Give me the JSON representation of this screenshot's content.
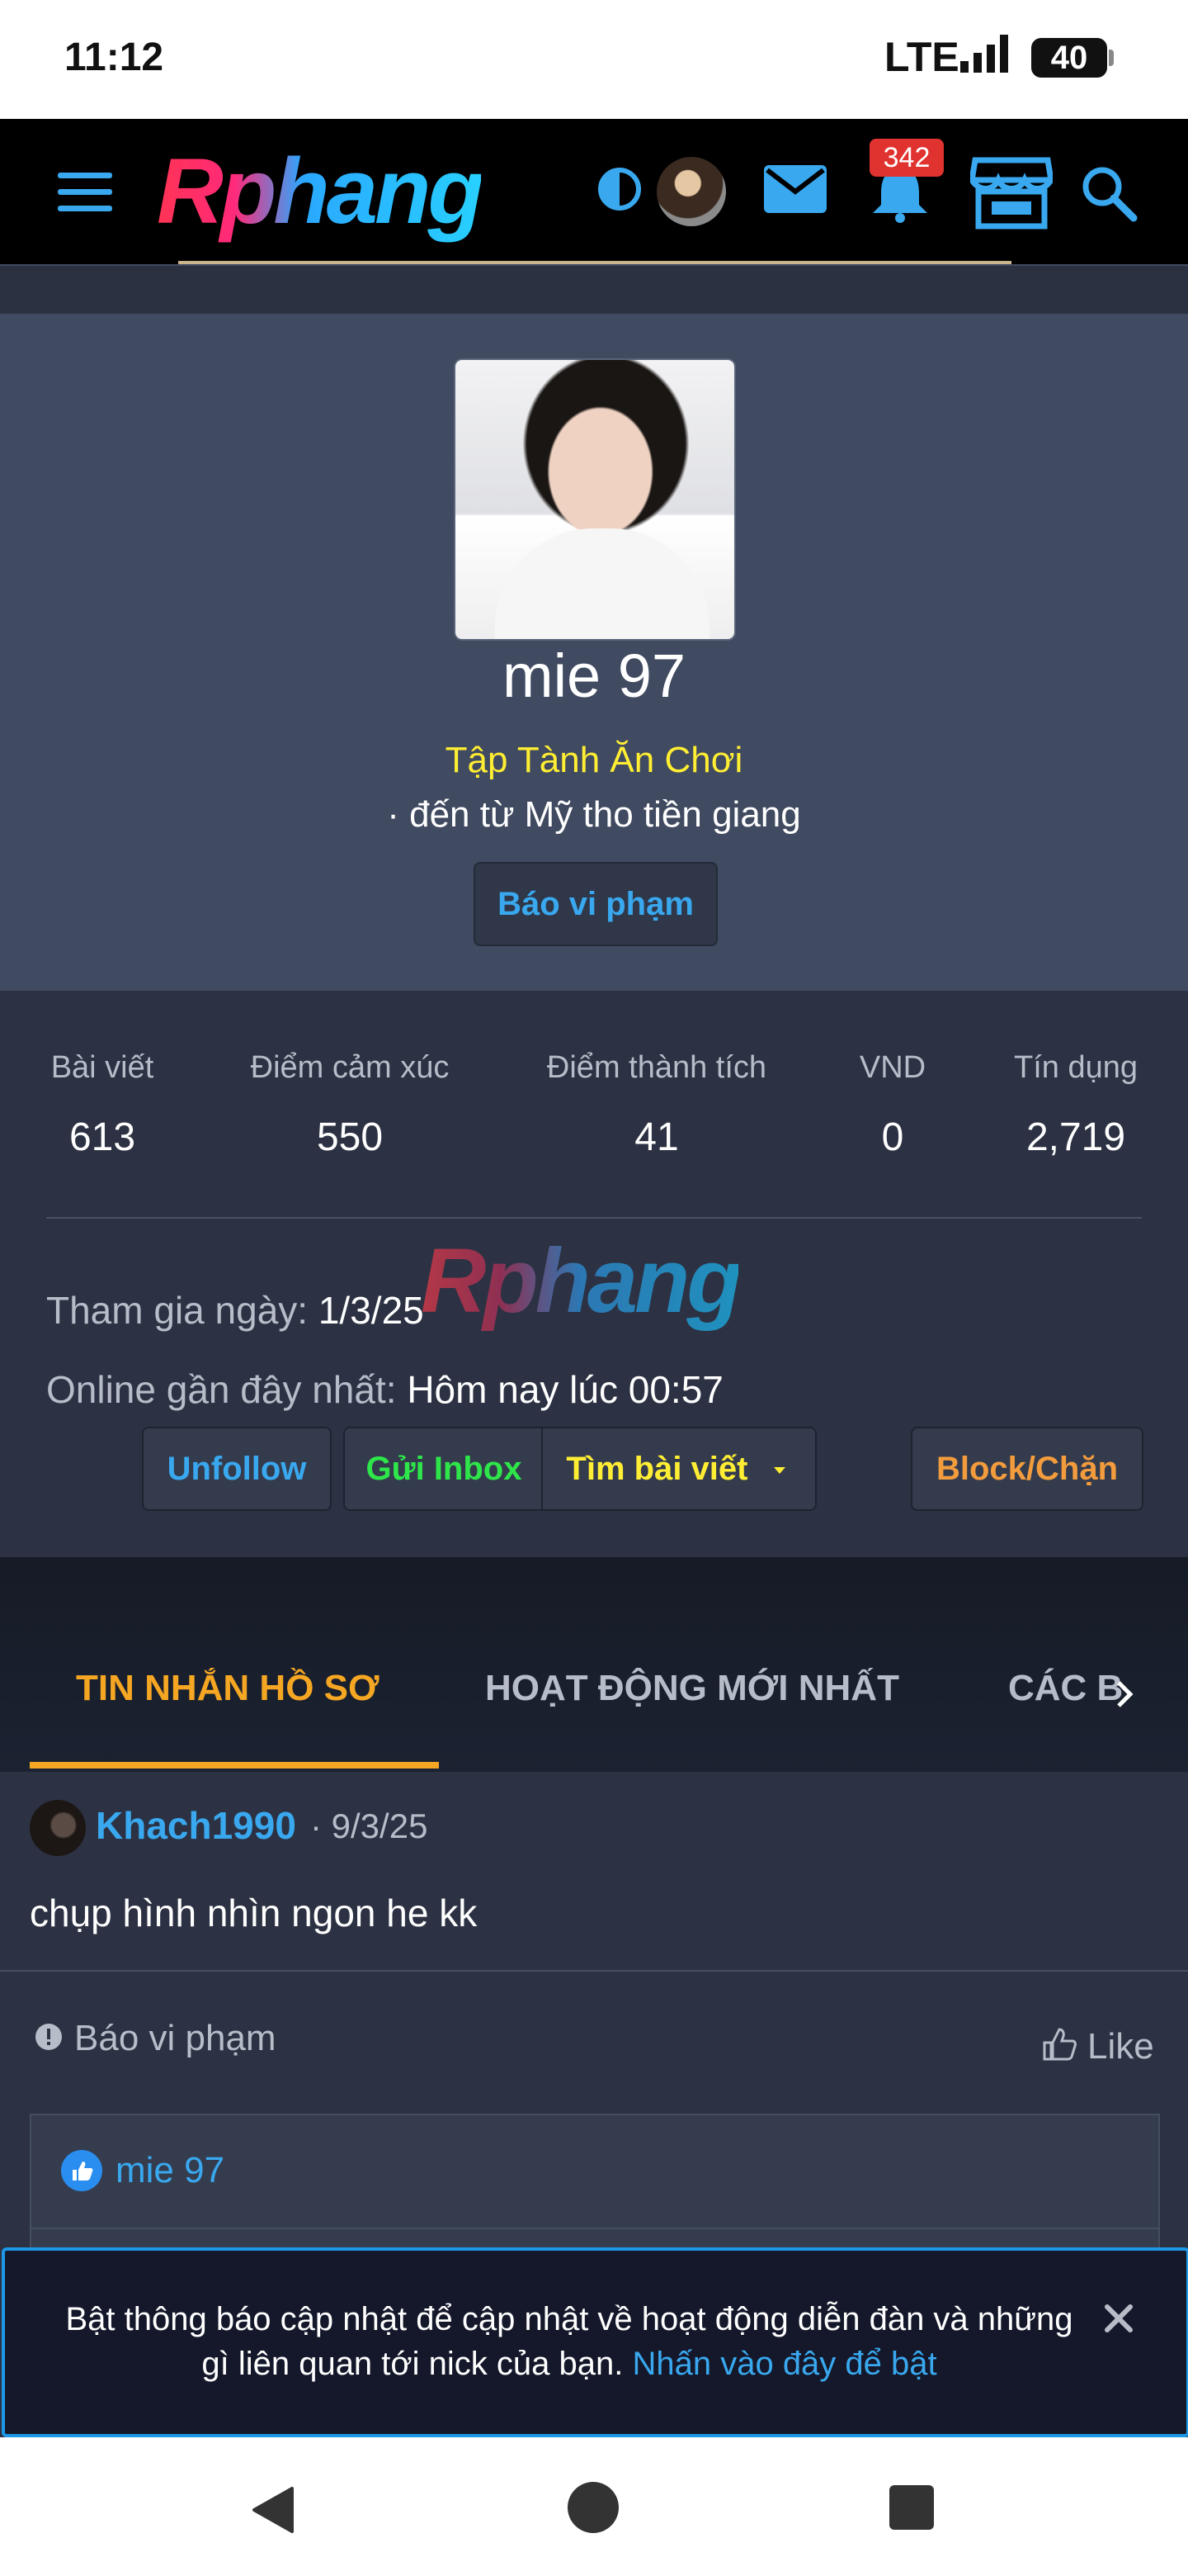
{
  "status_bar": {
    "time": "11:12",
    "network": "LTE",
    "battery": "40"
  },
  "header": {
    "logo_text": "Rphang",
    "notification_count": "342",
    "icons": [
      "menu-icon",
      "theme-toggle-icon",
      "avatar",
      "mail-icon",
      "bell-icon",
      "store-icon",
      "search-icon"
    ]
  },
  "profile": {
    "name": "mie 97",
    "title": "Tập Tành Ăn Chơi",
    "location": "· đến từ Mỹ tho tiền giang",
    "report_button": "Báo vi phạm"
  },
  "stats": [
    {
      "label": "Bài viết",
      "value": "613"
    },
    {
      "label": "Điểm cảm xúc",
      "value": "550"
    },
    {
      "label": "Điểm thành tích",
      "value": "41"
    },
    {
      "label": "VND",
      "value": "0"
    },
    {
      "label": "Tín dụng",
      "value": "2,719"
    }
  ],
  "watermark": "Rphang",
  "info": {
    "joined_label": "Tham gia ngày:",
    "joined_value": "1/3/25",
    "online_label": "Online gần đây nhất:",
    "online_value": "Hôm nay lúc 00:57"
  },
  "actions": {
    "unfollow": "Unfollow",
    "inbox": "Gửi Inbox",
    "find_posts": "Tìm bài viết",
    "block": "Block/Chặn"
  },
  "tabs": [
    {
      "label": "TIN NHẮN HỒ SƠ",
      "active": true
    },
    {
      "label": "HOẠT ĐỘNG MỚI NHẤT",
      "active": false
    },
    {
      "label": "CÁC B",
      "active": false
    }
  ],
  "post": {
    "author": "Khach1990",
    "date": "· 9/3/25",
    "body": "chụp hình nhìn ngon he kk",
    "report": "Báo vi phạm",
    "like": "Like",
    "liked_by": "mie 97"
  },
  "notice": {
    "text": "Bật thông báo cập nhật để cập nhật về hoạt động diễn đàn và những gì liên quan tới nick của bạn.",
    "link": "Nhấn vào đây để bật"
  },
  "colors": {
    "accent_blue": "#39a8ef",
    "accent_orange": "#f5a623",
    "title_yellow": "#ffee33",
    "inbox_green": "#2ee64a",
    "badge_red": "#e0332f"
  }
}
